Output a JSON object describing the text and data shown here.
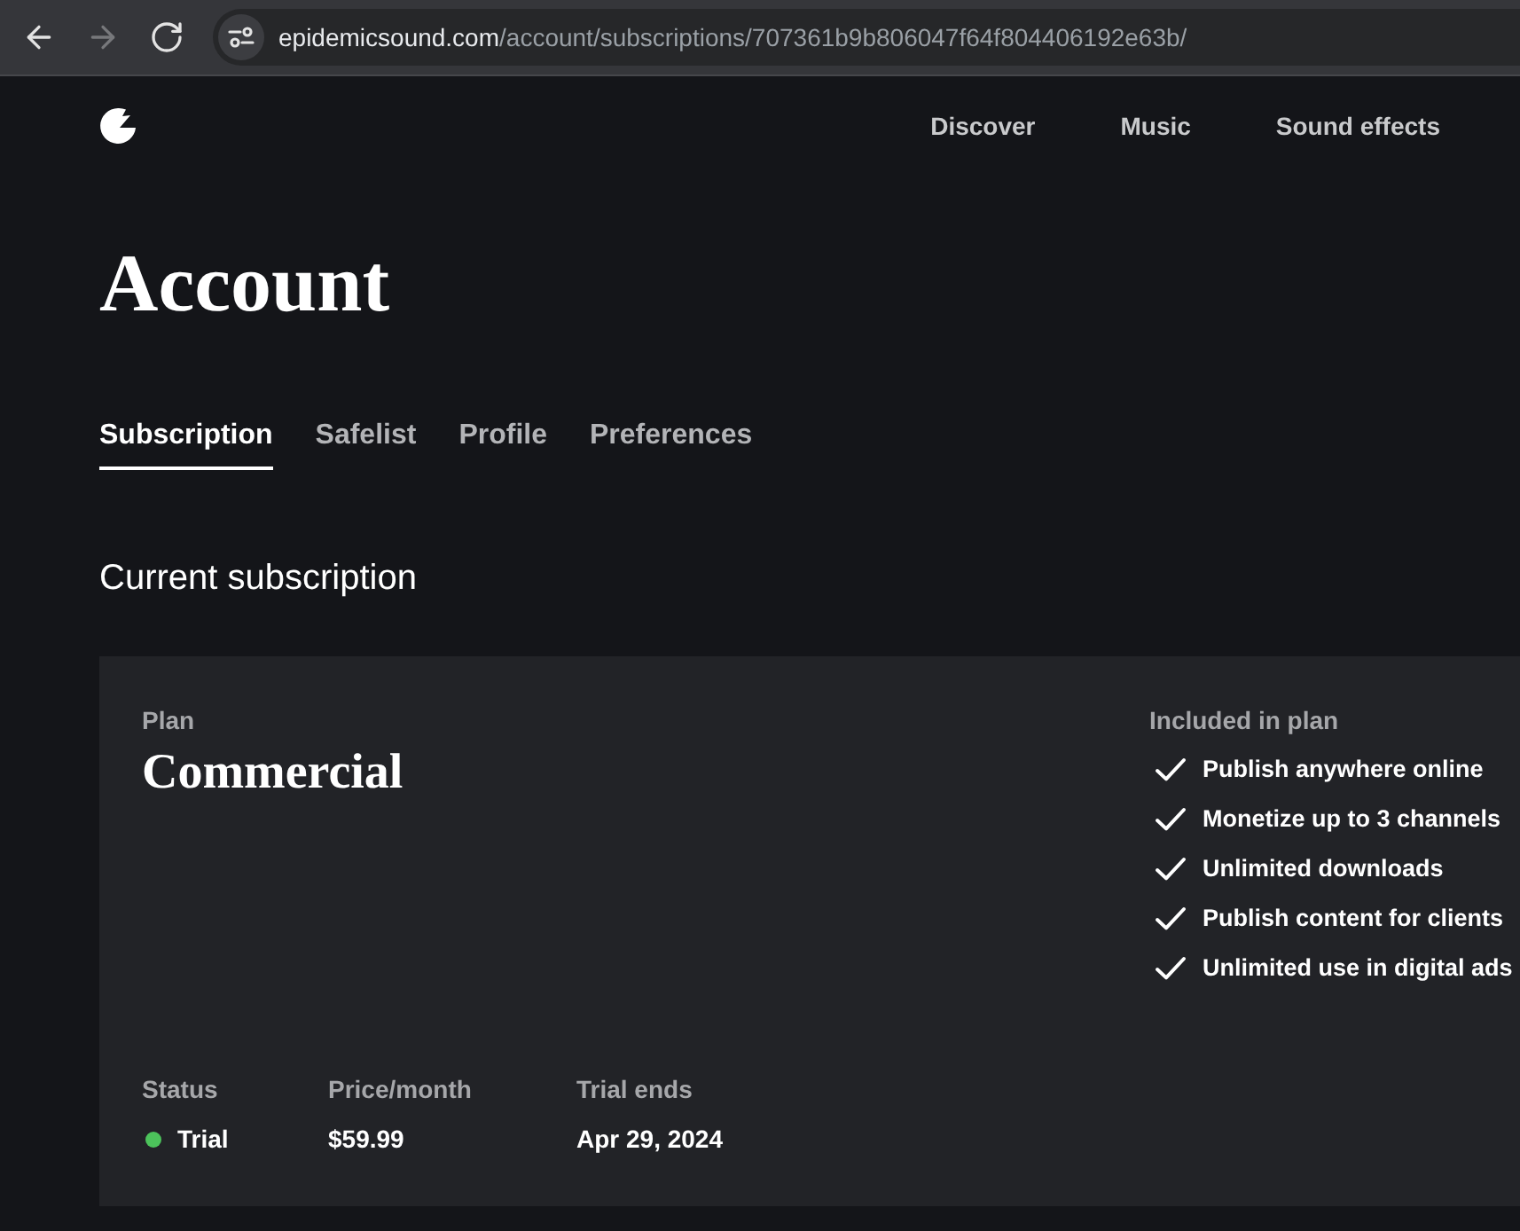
{
  "browser": {
    "nav_buttons": [
      {
        "kind": "back",
        "disabled": false
      },
      {
        "kind": "forward",
        "disabled": true
      },
      {
        "kind": "reload",
        "disabled": false
      }
    ],
    "address_bar": {
      "domain": "epidemicsound.com",
      "path": "/account/subscriptions/707361b9b806047f64f804406192e63b/"
    }
  },
  "header": {
    "nav_links": [
      "Discover",
      "Music",
      "Sound effects"
    ]
  },
  "page_title": "Account",
  "tabs": [
    {
      "label": "Subscription",
      "selected": true
    },
    {
      "label": "Safelist",
      "selected": false
    },
    {
      "label": "Profile",
      "selected": false
    },
    {
      "label": "Preferences",
      "selected": false
    }
  ],
  "section_title": "Current subscription",
  "plan_card": {
    "plan_label": "Plan",
    "plan_name": "Commercial",
    "included_title": "Included in plan",
    "features": [
      "Publish anywhere online",
      "Monetize up to 3 channels",
      "Unlimited downloads",
      "Publish content for clients",
      "Unlimited use in digital ads"
    ],
    "stats": [
      {
        "kind": "status",
        "label": "Status",
        "value": "Trial",
        "color": "#4cc35b"
      },
      {
        "kind": "text",
        "label": "Price/month",
        "value": "$59.99"
      },
      {
        "kind": "text",
        "label": "Trial ends",
        "value": "Apr 29, 2024"
      }
    ]
  }
}
